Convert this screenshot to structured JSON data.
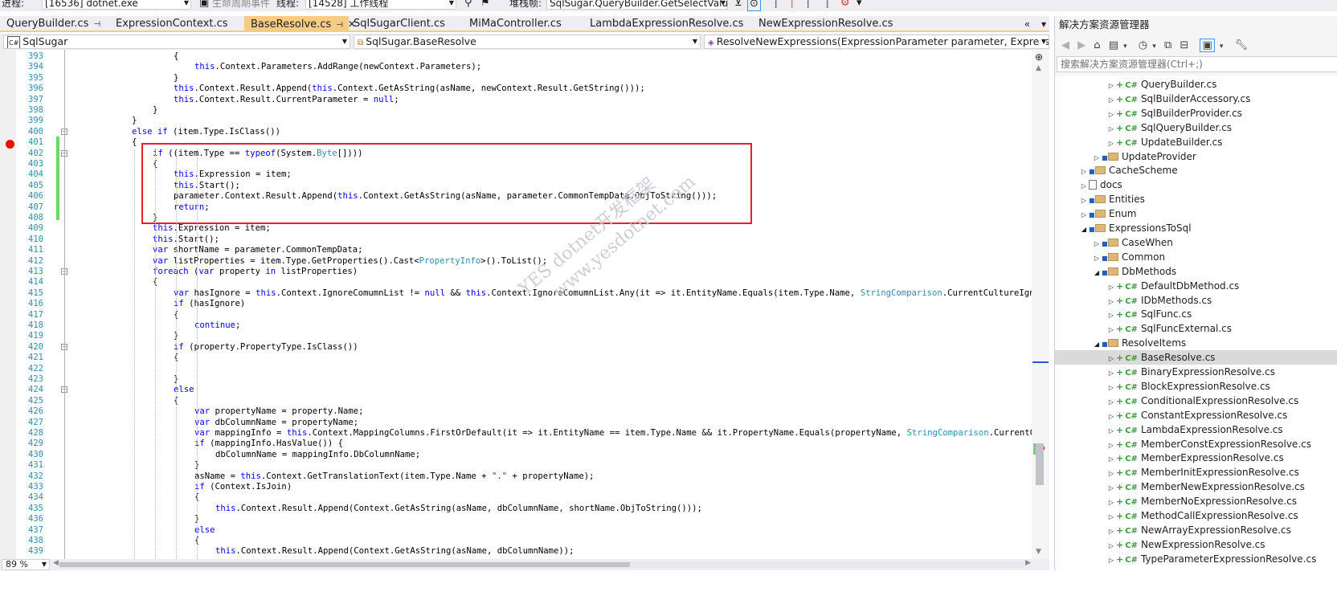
{
  "toolbar": {
    "process_label": "进程:",
    "process_value": "[16536] dotnet.exe",
    "lifecycle_label": "生命周期事件",
    "thread_label": "线程:",
    "thread_value": "[14528] 工作线程",
    "stack_label": "堆栈帧:",
    "stack_value": "SqlSugar.QueryBuilder.GetSelectValue"
  },
  "tabs": [
    {
      "label": "QueryBuilder.cs",
      "pin": "⊣"
    },
    {
      "label": "ExpressionContext.cs"
    },
    {
      "label": "BaseResolve.cs",
      "pin": "⊣",
      "close": "✕"
    },
    {
      "label": "SqlSugarClient.cs"
    },
    {
      "label": "MiMaController.cs"
    },
    {
      "label": "LambdaExpressionResolve.cs"
    },
    {
      "label": "NewExpressionResolve.cs"
    }
  ],
  "navbar": {
    "project": "SqlSugar",
    "class": "SqlSugar.BaseResolve",
    "member": "ResolveNewExpressions(ExpressionParameter parameter, Expression item, string asName)"
  },
  "editor": {
    "zoom": "89 %",
    "lines": [
      {
        "n": "393",
        "indent": 8,
        "tokens": [
          {
            "t": "{"
          }
        ]
      },
      {
        "n": "394",
        "indent": 12,
        "tokens": [
          {
            "t": "this",
            "c": "kw"
          },
          {
            "t": ".Context.Parameters.AddRange(newContext.Parameters);"
          }
        ]
      },
      {
        "n": "395",
        "indent": 8,
        "tokens": [
          {
            "t": "}"
          }
        ]
      },
      {
        "n": "396",
        "indent": 8,
        "tokens": [
          {
            "t": "this",
            "c": "kw"
          },
          {
            "t": ".Context.Result.Append("
          },
          {
            "t": "this",
            "c": "kw"
          },
          {
            "t": ".Context.GetAsString(asName, newContext.Result.GetString()));"
          }
        ]
      },
      {
        "n": "397",
        "indent": 8,
        "tokens": [
          {
            "t": "this",
            "c": "kw"
          },
          {
            "t": ".Context.Result.CurrentParameter = "
          },
          {
            "t": "null",
            "c": "kw"
          },
          {
            "t": ";"
          }
        ]
      },
      {
        "n": "398",
        "indent": 4,
        "tokens": [
          {
            "t": "}"
          }
        ]
      },
      {
        "n": "399",
        "indent": 0,
        "tokens": [
          {
            "t": "}"
          }
        ]
      },
      {
        "n": "400",
        "indent": 0,
        "tokens": [
          {
            "t": "else",
            "c": "kw"
          },
          {
            "t": " "
          },
          {
            "t": "if",
            "c": "kw"
          },
          {
            "t": " (item.Type.IsClass())"
          }
        ]
      },
      {
        "n": "401",
        "indent": 0,
        "tokens": [
          {
            "t": "{"
          }
        ]
      },
      {
        "n": "402",
        "indent": 4,
        "tokens": [
          {
            "t": "if",
            "c": "kw"
          },
          {
            "t": " ((item.Type == "
          },
          {
            "t": "typeof",
            "c": "kw"
          },
          {
            "t": "(System."
          },
          {
            "t": "Byte",
            "c": "ty"
          },
          {
            "t": "[])))"
          }
        ]
      },
      {
        "n": "403",
        "indent": 4,
        "tokens": [
          {
            "t": "{"
          }
        ]
      },
      {
        "n": "404",
        "indent": 8,
        "tokens": [
          {
            "t": "this",
            "c": "kw"
          },
          {
            "t": ".Expression = item;"
          }
        ]
      },
      {
        "n": "405",
        "indent": 8,
        "tokens": [
          {
            "t": "this",
            "c": "kw"
          },
          {
            "t": ".Start();"
          }
        ]
      },
      {
        "n": "406",
        "indent": 8,
        "tokens": [
          {
            "t": "parameter.Context.Result.Append("
          },
          {
            "t": "this",
            "c": "kw"
          },
          {
            "t": ".Context.GetAsString(asName, parameter.CommonTempData.ObjToString()));"
          }
        ]
      },
      {
        "n": "407",
        "indent": 8,
        "tokens": [
          {
            "t": "return",
            "c": "kw"
          },
          {
            "t": ";"
          }
        ]
      },
      {
        "n": "408",
        "indent": 4,
        "tokens": [
          {
            "t": "}"
          }
        ]
      },
      {
        "n": "409",
        "indent": 4,
        "tokens": [
          {
            "t": "this",
            "c": "kw"
          },
          {
            "t": ".Expression = item;"
          }
        ]
      },
      {
        "n": "410",
        "indent": 4,
        "tokens": [
          {
            "t": "this",
            "c": "kw"
          },
          {
            "t": ".Start();"
          }
        ]
      },
      {
        "n": "411",
        "indent": 4,
        "tokens": [
          {
            "t": "var",
            "c": "kw"
          },
          {
            "t": " shortName = parameter.CommonTempData;"
          }
        ]
      },
      {
        "n": "412",
        "indent": 4,
        "tokens": [
          {
            "t": "var",
            "c": "kw"
          },
          {
            "t": " listProperties = item.Type.GetProperties().Cast<"
          },
          {
            "t": "PropertyInfo",
            "c": "ty"
          },
          {
            "t": ">().ToList();"
          }
        ]
      },
      {
        "n": "413",
        "indent": 4,
        "tokens": [
          {
            "t": "foreach",
            "c": "kw"
          },
          {
            "t": " ("
          },
          {
            "t": "var",
            "c": "kw"
          },
          {
            "t": " property "
          },
          {
            "t": "in",
            "c": "kw"
          },
          {
            "t": " listProperties)"
          }
        ]
      },
      {
        "n": "414",
        "indent": 4,
        "tokens": [
          {
            "t": "{"
          }
        ]
      },
      {
        "n": "415",
        "indent": 8,
        "tokens": [
          {
            "t": "var",
            "c": "kw"
          },
          {
            "t": " hasIgnore = "
          },
          {
            "t": "this",
            "c": "kw"
          },
          {
            "t": ".Context.IgnoreComumnList != "
          },
          {
            "t": "null",
            "c": "kw"
          },
          {
            "t": " && "
          },
          {
            "t": "this",
            "c": "kw"
          },
          {
            "t": ".Context.IgnoreComumnList.Any(it => it.EntityName.Equals(item.Type.Name, "
          },
          {
            "t": "StringComparison",
            "c": "ty"
          },
          {
            "t": ".CurrentCultureIgnoreCase) && it.PropertyName.Equals(property.Name,"
          }
        ]
      },
      {
        "n": "416",
        "indent": 8,
        "tokens": [
          {
            "t": "if",
            "c": "kw"
          },
          {
            "t": " (hasIgnore)"
          }
        ]
      },
      {
        "n": "417",
        "indent": 8,
        "tokens": [
          {
            "t": "{"
          }
        ]
      },
      {
        "n": "418",
        "indent": 12,
        "tokens": [
          {
            "t": "continue",
            "c": "kw"
          },
          {
            "t": ";"
          }
        ]
      },
      {
        "n": "419",
        "indent": 8,
        "tokens": [
          {
            "t": "}"
          }
        ]
      },
      {
        "n": "420",
        "indent": 8,
        "tokens": [
          {
            "t": "if",
            "c": "kw"
          },
          {
            "t": " (property.PropertyType.IsClass())"
          }
        ]
      },
      {
        "n": "421",
        "indent": 8,
        "tokens": [
          {
            "t": "{"
          }
        ]
      },
      {
        "n": "422",
        "indent": 8,
        "tokens": [
          {
            "t": ""
          }
        ]
      },
      {
        "n": "423",
        "indent": 8,
        "tokens": [
          {
            "t": "}"
          }
        ]
      },
      {
        "n": "424",
        "indent": 8,
        "tokens": [
          {
            "t": "else",
            "c": "kw"
          }
        ]
      },
      {
        "n": "425",
        "indent": 8,
        "tokens": [
          {
            "t": "{"
          }
        ]
      },
      {
        "n": "426",
        "indent": 12,
        "tokens": [
          {
            "t": "var",
            "c": "kw"
          },
          {
            "t": " propertyName = property.Name;"
          }
        ]
      },
      {
        "n": "427",
        "indent": 12,
        "tokens": [
          {
            "t": "var",
            "c": "kw"
          },
          {
            "t": " dbColumnName = propertyName;"
          }
        ]
      },
      {
        "n": "428",
        "indent": 12,
        "tokens": [
          {
            "t": "var",
            "c": "kw"
          },
          {
            "t": " mappingInfo = "
          },
          {
            "t": "this",
            "c": "kw"
          },
          {
            "t": ".Context.MappingColumns.FirstOrDefault(it => it.EntityName == item.Type.Name && it.PropertyName.Equals(propertyName, "
          },
          {
            "t": "StringComparison",
            "c": "ty"
          },
          {
            "t": ".CurrentCultureIgnoreCase));"
          }
        ]
      },
      {
        "n": "429",
        "indent": 12,
        "tokens": [
          {
            "t": "if",
            "c": "kw"
          },
          {
            "t": " (mappingInfo.HasValue()) {"
          }
        ]
      },
      {
        "n": "430",
        "indent": 16,
        "tokens": [
          {
            "t": "dbColumnName = mappingInfo.DbColumnName;"
          }
        ]
      },
      {
        "n": "431",
        "indent": 12,
        "tokens": [
          {
            "t": "}"
          }
        ]
      },
      {
        "n": "432",
        "indent": 12,
        "tokens": [
          {
            "t": "asName = "
          },
          {
            "t": "this",
            "c": "kw"
          },
          {
            "t": ".Context.GetTranslationText(item.Type.Name + "
          },
          {
            "t": "\".\"",
            "c": "st"
          },
          {
            "t": " + propertyName);"
          }
        ]
      },
      {
        "n": "433",
        "indent": 12,
        "tokens": [
          {
            "t": "if",
            "c": "kw"
          },
          {
            "t": " (Context.IsJoin)"
          }
        ]
      },
      {
        "n": "434",
        "indent": 12,
        "tokens": [
          {
            "t": "{"
          }
        ]
      },
      {
        "n": "435",
        "indent": 16,
        "tokens": [
          {
            "t": "this",
            "c": "kw"
          },
          {
            "t": ".Context.Result.Append(Context.GetAsString(asName, dbColumnName, shortName.ObjToString()));"
          }
        ]
      },
      {
        "n": "436",
        "indent": 12,
        "tokens": [
          {
            "t": "}"
          }
        ]
      },
      {
        "n": "437",
        "indent": 12,
        "tokens": [
          {
            "t": "else",
            "c": "kw"
          }
        ]
      },
      {
        "n": "438",
        "indent": 12,
        "tokens": [
          {
            "t": "{"
          }
        ]
      },
      {
        "n": "439",
        "indent": 16,
        "tokens": [
          {
            "t": "this",
            "c": "kw"
          },
          {
            "t": ".Context.Result.Append(Context.GetAsString(asName, dbColumnName));"
          }
        ]
      }
    ]
  },
  "watermark": {
    "line1": "YES dotnet开发框架",
    "line2": "www.yesdotnet.com"
  },
  "solution": {
    "title": "解决方案资源管理器",
    "search_placeholder": "搜索解决方案资源管理器(Ctrl+;)",
    "nodes": [
      {
        "label": "QueryBuilder.cs",
        "kind": "cs"
      },
      {
        "label": "SqlBuilderAccessory.cs",
        "kind": "cs"
      },
      {
        "label": "SqlBuilderProvider.cs",
        "kind": "cs"
      },
      {
        "label": "SqlQueryBuilder.cs",
        "kind": "cs"
      },
      {
        "label": "UpdateBuilder.cs",
        "kind": "cs"
      },
      {
        "label": "UpdateProvider",
        "kind": "folder"
      },
      {
        "label": "CacheScheme",
        "kind": "folder"
      },
      {
        "label": "docs",
        "kind": "doc"
      },
      {
        "label": "Entities",
        "kind": "folder"
      },
      {
        "label": "Enum",
        "kind": "folder"
      },
      {
        "label": "ExpressionsToSql",
        "kind": "folder-open"
      },
      {
        "label": "CaseWhen",
        "kind": "folder"
      },
      {
        "label": "Common",
        "kind": "folder"
      },
      {
        "label": "DbMethods",
        "kind": "folder-open"
      },
      {
        "label": "DefaultDbMethod.cs",
        "kind": "cs"
      },
      {
        "label": "IDbMethods.cs",
        "kind": "cs"
      },
      {
        "label": "SqlFunc.cs",
        "kind": "cs"
      },
      {
        "label": "SqlFuncExternal.cs",
        "kind": "cs"
      },
      {
        "label": "ResolveItems",
        "kind": "folder-open"
      },
      {
        "label": "BaseResolve.cs",
        "kind": "cs",
        "selected": true
      },
      {
        "label": "BinaryExpressionResolve.cs",
        "kind": "cs"
      },
      {
        "label": "BlockExpressionResolve.cs",
        "kind": "cs"
      },
      {
        "label": "ConditionalExpressionResolve.cs",
        "kind": "cs"
      },
      {
        "label": "ConstantExpressionResolve.cs",
        "kind": "cs"
      },
      {
        "label": "LambdaExpressionResolve.cs",
        "kind": "cs"
      },
      {
        "label": "MemberConstExpressionResolve.cs",
        "kind": "cs"
      },
      {
        "label": "MemberExpressionResolve.cs",
        "kind": "cs"
      },
      {
        "label": "MemberInitExpressionResolve.cs",
        "kind": "cs"
      },
      {
        "label": "MemberNewExpressionResolve.cs",
        "kind": "cs"
      },
      {
        "label": "MemberNoExpressionResolve.cs",
        "kind": "cs"
      },
      {
        "label": "MethodCallExpressionResolve.cs",
        "kind": "cs"
      },
      {
        "label": "NewArrayExpressionResolve.cs",
        "kind": "cs"
      },
      {
        "label": "NewExpressionResolve.cs",
        "kind": "cs"
      },
      {
        "label": "TypeParameterExpressionResolve.cs",
        "kind": "cs"
      }
    ]
  },
  "colors": {
    "keyword": "#0000ff",
    "type": "#2b91af",
    "line_number": "#2b91af",
    "highlight_box": "#e8202a",
    "breakpoint": "#e51400",
    "active_tab": "#f5cc84"
  }
}
